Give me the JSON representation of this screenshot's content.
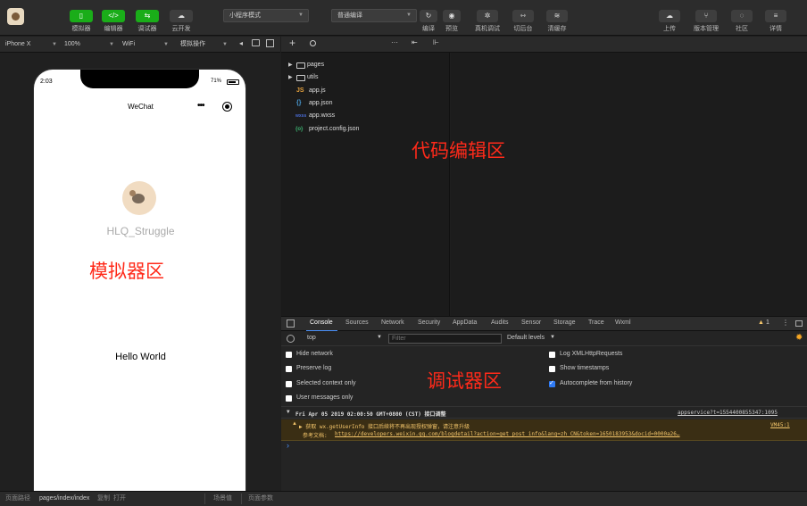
{
  "toolbar": {
    "buttons": [
      {
        "id": "simulator",
        "label": "模拟器",
        "icon": "phone-icon",
        "glyph": "▯"
      },
      {
        "id": "editor",
        "label": "编辑器",
        "icon": "code-icon",
        "glyph": "</>"
      },
      {
        "id": "debugger",
        "label": "调试器",
        "icon": "debug-icon",
        "glyph": "⇆"
      },
      {
        "id": "cloud",
        "label": "云开发",
        "icon": "cloud-icon",
        "glyph": "☁"
      }
    ],
    "mode_select": "小程序模式",
    "compile_select": "普通编译",
    "right_buttons": [
      {
        "id": "compile",
        "label": "编译",
        "glyph": "↻"
      },
      {
        "id": "preview",
        "label": "预览",
        "glyph": "◉"
      },
      {
        "id": "real-debug",
        "label": "真机调试",
        "glyph": "✲"
      },
      {
        "id": "background",
        "label": "切后台",
        "glyph": "⇿"
      },
      {
        "id": "clear-cache",
        "label": "清缓存",
        "glyph": "≋"
      }
    ],
    "far_right_buttons": [
      {
        "id": "upload",
        "label": "上传",
        "glyph": "☁"
      },
      {
        "id": "version",
        "label": "版本管理",
        "glyph": "⑂"
      },
      {
        "id": "community",
        "label": "社区",
        "glyph": "◌"
      },
      {
        "id": "details",
        "label": "详情",
        "glyph": "≡"
      }
    ]
  },
  "simbar": {
    "device": "iPhone X",
    "zoom": "100%",
    "network": "WiFi",
    "operation": "模拟操作"
  },
  "phone": {
    "time": "2:03",
    "battery": "71%",
    "nav_title": "WeChat",
    "username": "HLQ_Struggle",
    "hello": "Hello World"
  },
  "filetree": {
    "items": [
      {
        "name": "pages",
        "type": "folder"
      },
      {
        "name": "utils",
        "type": "folder"
      },
      {
        "name": "app.js",
        "type": "js",
        "icon": "JS"
      },
      {
        "name": "app.json",
        "type": "json",
        "icon": "{}"
      },
      {
        "name": "app.wxss",
        "type": "wxss",
        "icon": "wxss"
      },
      {
        "name": "project.config.json",
        "type": "config",
        "icon": "{o}"
      }
    ]
  },
  "regions": {
    "editor": "代码编辑区",
    "simulator": "模拟器区",
    "debugger": "调试器区"
  },
  "devtools": {
    "tabs": [
      "Console",
      "Sources",
      "Network",
      "Security",
      "AppData",
      "Audits",
      "Sensor",
      "Storage",
      "Trace",
      "Wxml"
    ],
    "warning_count": "1",
    "context": "top",
    "filter_placeholder": "Filter",
    "levels": "Default levels",
    "options_left": [
      "Hide network",
      "Preserve log",
      "Selected context only",
      "User messages only"
    ],
    "options_right": [
      {
        "label": "Log XMLHttpRequests",
        "checked": false
      },
      {
        "label": "Show timestamps",
        "checked": false
      },
      {
        "label": "Autocomplete from history",
        "checked": true
      }
    ],
    "log_group": "Fri Apr 05 2019 02:00:50 GMT+0800 (CST) 接口调整",
    "log_group_source": "appservice?t=1554400855347:1095",
    "warn_line1": "获取 wx.getUserInfo 接口后续将不再出现授权弹窗，请注意升级",
    "warn_source": "VM45:1",
    "warn_line2_prefix": "参考文档:",
    "warn_link": "https://developers.weixin.qq.com/blogdetail?action=get_post_info&lang=zh_CN&token=1650183953&docid=0000a26…",
    "prompt": "›"
  },
  "statusbar": {
    "path_label": "页面路径",
    "path": "pages/index/index",
    "copy": "复制",
    "open": "打开",
    "scene": "场景值",
    "params": "页面参数"
  },
  "colors": {
    "accent_green": "#1aad19",
    "region_label": "#ff2a1a",
    "link": "#8ab4f8",
    "warn_bg": "#3a2e14",
    "warn_text": "#f5c66b"
  }
}
